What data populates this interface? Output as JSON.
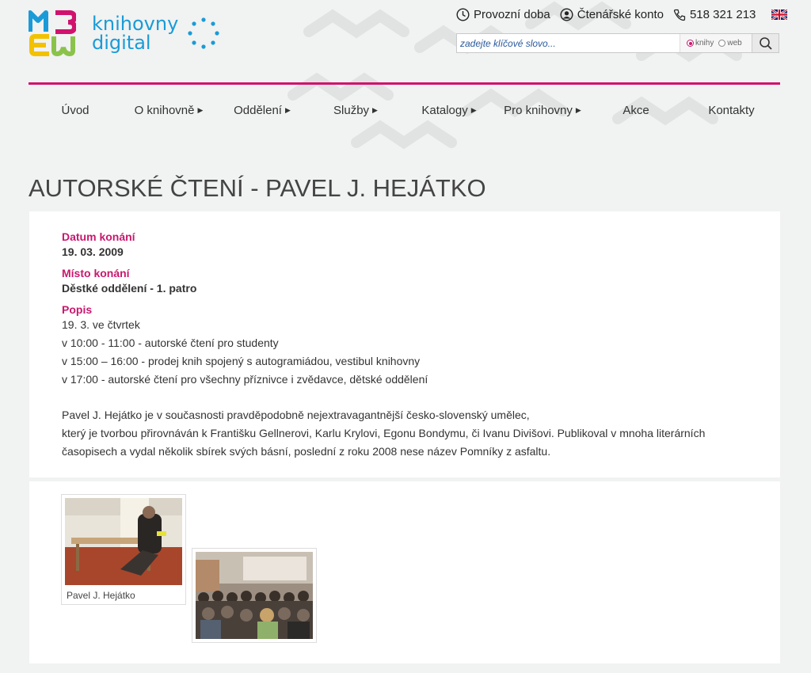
{
  "brand": {
    "logo_line1": "knihovny",
    "logo_line2": "digital"
  },
  "utility": {
    "hours_label": "Provozní doba",
    "account_label": "Čtenářské konto",
    "phone": "518 321 213"
  },
  "search": {
    "placeholder": "zadejte klíčové slovo...",
    "option_books": "knihy",
    "option_web": "web",
    "selected": "knihy"
  },
  "nav": {
    "items": [
      {
        "label": "Úvod",
        "has_submenu": false
      },
      {
        "label": "O knihovně",
        "has_submenu": true
      },
      {
        "label": "Oddělení",
        "has_submenu": true
      },
      {
        "label": "Služby",
        "has_submenu": true
      },
      {
        "label": "Katalogy",
        "has_submenu": true
      },
      {
        "label": "Pro knihovny",
        "has_submenu": true
      },
      {
        "label": "Akce",
        "has_submenu": false
      },
      {
        "label": "Kontakty",
        "has_submenu": false
      }
    ]
  },
  "page": {
    "title": "AUTORSKÉ ČTENÍ - PAVEL J. HEJÁTKO"
  },
  "event": {
    "date_label": "Datum konání",
    "date_value": "19. 03. 2009",
    "place_label": "Místo konání",
    "place_value": "Děstké oddělení - 1. patro",
    "desc_label": "Popis",
    "desc_lines": [
      "19. 3. ve čtvrtek",
      "v 10:00 - 11:00 - autorské čtení pro studenty",
      "v 15:00 – 16:00 - prodej knih spojený s autogramiádou, vestibul knihovny",
      "v 17:00 - autorské čtení pro všechny příznivce i zvědavce, dětské oddělení"
    ],
    "paragraph_lines": [
      "Pavel J. Hejátko je v současnosti pravděpodobně nejextravagantnější česko-slovenský umělec,",
      "který je tvorbou přirovnáván k Františku Gellnerovi, Karlu Krylovi, Egonu Bondymu, či Ivanu Divišovi. Publikoval v mnoha literárních",
      "časopisech a vydal několik sbírek svých básní, poslední z roku 2008 nese název Pomníky z asfaltu."
    ]
  },
  "gallery": {
    "items": [
      {
        "caption": "Pavel J. Hejátko"
      },
      {
        "caption": ""
      }
    ]
  },
  "colors": {
    "accent": "#c8186e",
    "rule": "#d1126d",
    "logo_blue": "#1a9bd7"
  }
}
